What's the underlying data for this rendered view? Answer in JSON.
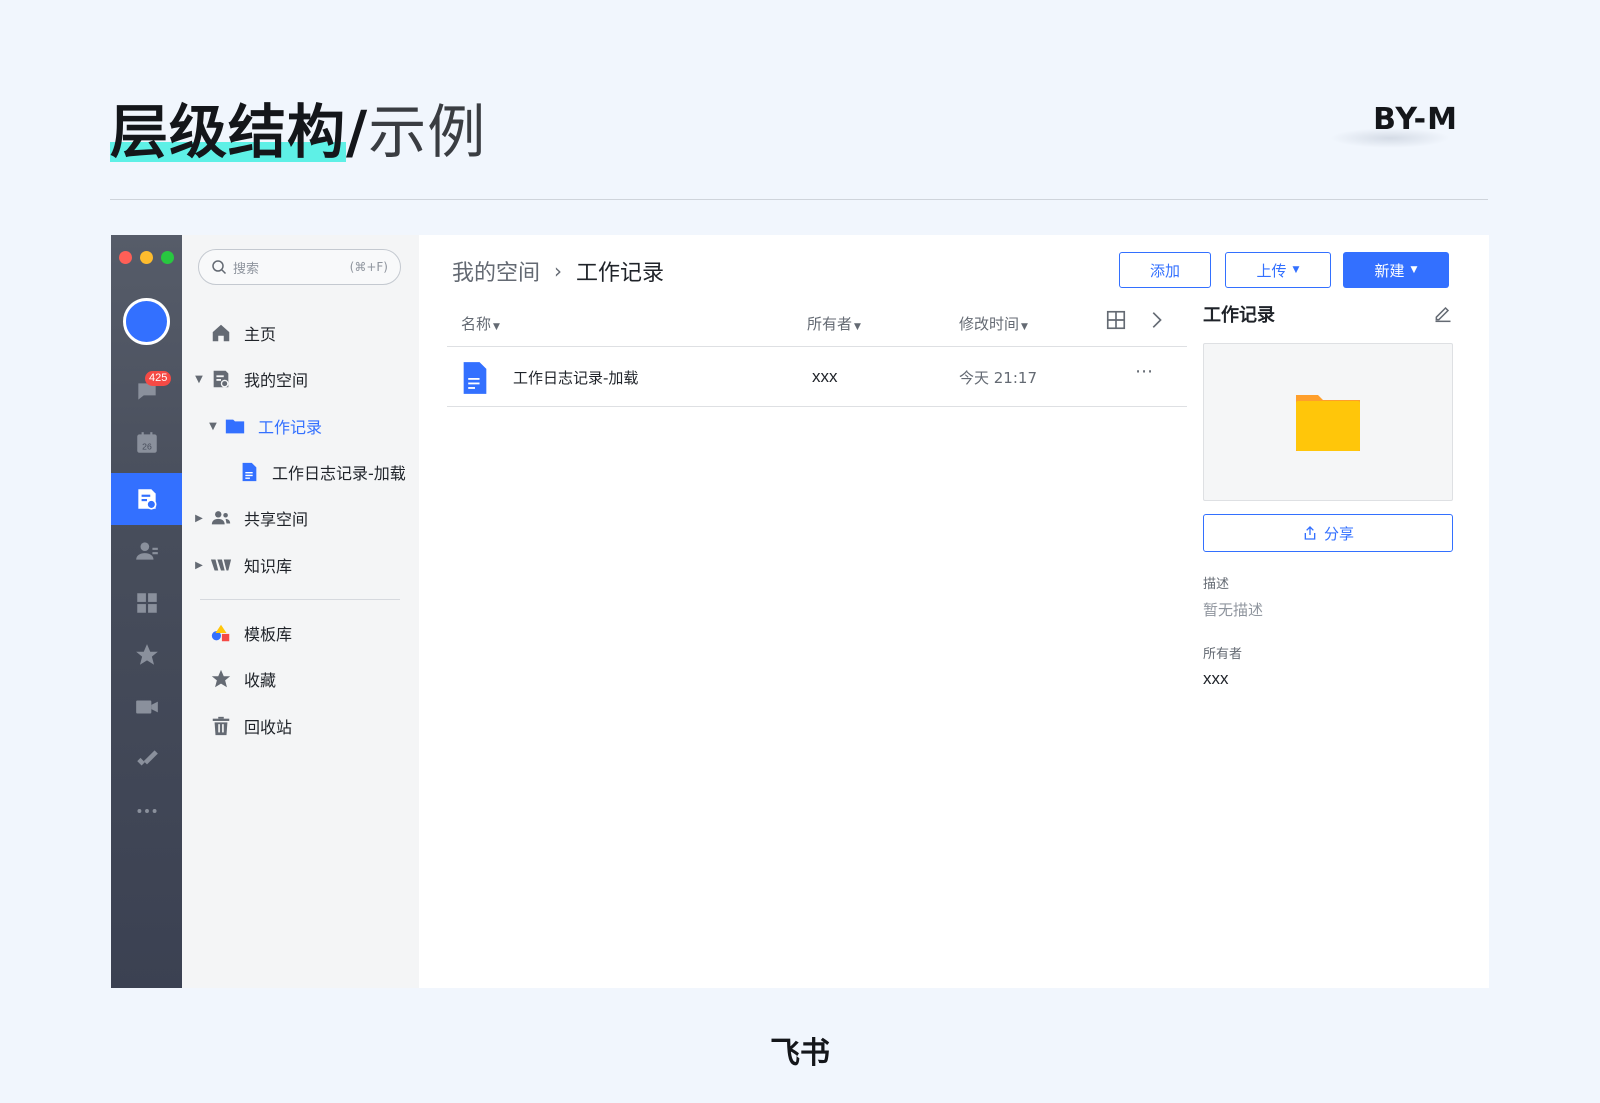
{
  "slide": {
    "title_bold": "层级结构",
    "title_sep": "/",
    "title_light": "示例",
    "byline": "BY-M",
    "caption": "飞书",
    "accent_color": "#5ef0e6"
  },
  "window": {
    "traffic_lights": [
      "#ff5f57",
      "#febc2e",
      "#28c840"
    ]
  },
  "rail": {
    "items": [
      {
        "icon": "chat-icon",
        "badge": "425"
      },
      {
        "icon": "calendar-icon",
        "label": "26"
      },
      {
        "icon": "docs-icon",
        "active": true
      },
      {
        "icon": "contacts-icon"
      },
      {
        "icon": "workplace-icon"
      },
      {
        "icon": "favorites-icon"
      },
      {
        "icon": "video-icon"
      },
      {
        "icon": "approval-icon"
      },
      {
        "icon": "more-icon"
      }
    ]
  },
  "sidebar": {
    "search_placeholder": "搜索",
    "search_shortcut": "(⌘+F)",
    "items": [
      {
        "label": "主页",
        "icon": "home-icon"
      },
      {
        "label": "我的空间",
        "icon": "my-space-icon",
        "expanded": true
      },
      {
        "label": "工作记录",
        "icon": "folder-icon",
        "expanded": true,
        "selected": true
      },
      {
        "label": "工作日志记录-加载",
        "icon": "doc-icon"
      },
      {
        "label": "共享空间",
        "icon": "shared-space-icon",
        "expanded": false
      },
      {
        "label": "知识库",
        "icon": "wiki-icon",
        "expanded": false
      },
      {
        "label": "模板库",
        "icon": "template-icon"
      },
      {
        "label": "收藏",
        "icon": "star-icon"
      },
      {
        "label": "回收站",
        "icon": "trash-icon"
      }
    ]
  },
  "main": {
    "breadcrumb": {
      "root": "我的空间",
      "separator": "›",
      "current": "工作记录"
    },
    "buttons": {
      "add": "添加",
      "upload": "上传",
      "create": "新建"
    },
    "columns": {
      "name": "名称",
      "owner": "所有者",
      "modified": "修改时间"
    },
    "rows": [
      {
        "name": "工作日志记录-加载",
        "owner": "xxx",
        "modified": "今天 21:17",
        "icon": "doc-icon"
      }
    ],
    "accent_color": "#3370ff"
  },
  "detail": {
    "title": "工作记录",
    "share": "分享",
    "description_label": "描述",
    "description_value": "暂无描述",
    "owner_label": "所有者",
    "owner_value": "xxx",
    "folder_color": "#ffc60a"
  }
}
